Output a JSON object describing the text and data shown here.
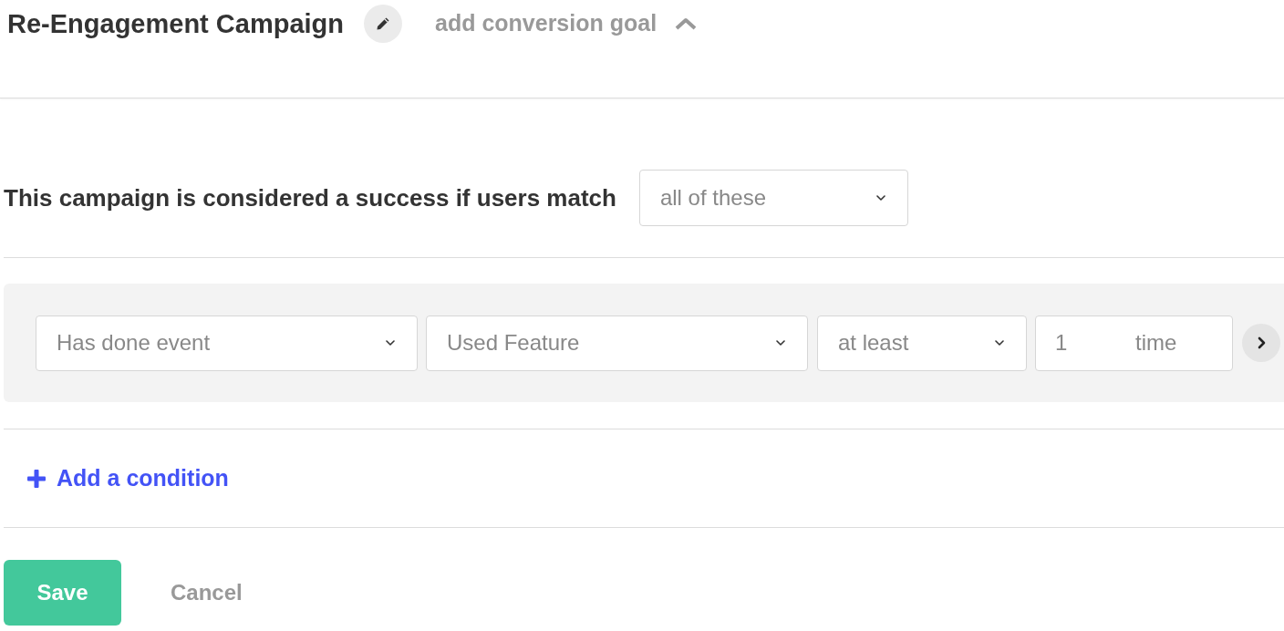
{
  "header": {
    "title": "Re-Engagement Campaign",
    "goal_link": {
      "label": "add conversion goal",
      "expanded": true
    }
  },
  "match": {
    "label": "This campaign is considered a success if users match",
    "value": "all of these"
  },
  "conditions": [
    {
      "fields": [
        {
          "kind": "select",
          "value": "Has done event"
        },
        {
          "kind": "select",
          "value": "Used Feature"
        },
        {
          "kind": "select",
          "value": "at least"
        },
        {
          "kind": "count",
          "value": "1",
          "unit": "time"
        }
      ]
    }
  ],
  "add_condition": {
    "label": "Add a condition"
  },
  "buttons": [
    {
      "label": "Save",
      "kind": "primary"
    },
    {
      "label": "Cancel",
      "kind": "secondary"
    }
  ]
}
